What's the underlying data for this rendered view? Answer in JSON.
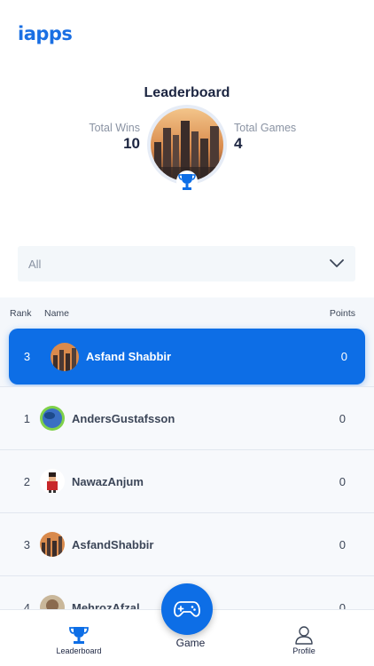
{
  "app": {
    "logo": "iapps"
  },
  "header": {
    "title": "Leaderboard"
  },
  "stats": {
    "wins": {
      "label": "Total Wins",
      "value": "10"
    },
    "games": {
      "label": "Total Games",
      "value": "4"
    }
  },
  "filter": {
    "selected": "All"
  },
  "table": {
    "headers": {
      "rank": "Rank",
      "name": "Name",
      "points": "Points"
    },
    "current_user": {
      "rank": "3",
      "name": "Asfand Shabbir",
      "points": "0"
    },
    "rows": [
      {
        "rank": "1",
        "name": "AndersGustafsson",
        "points": "0"
      },
      {
        "rank": "2",
        "name": "NawazAnjum",
        "points": "0"
      },
      {
        "rank": "3",
        "name": "AsfandShabbir",
        "points": "0"
      },
      {
        "rank": "4",
        "name": "MehrozAfzal",
        "points": "0"
      }
    ]
  },
  "tabbar": {
    "leaderboard": "Leaderboard",
    "game": "Game",
    "profile": "Profile"
  },
  "colors": {
    "accent": "#0d6ee6",
    "logo": "#1a6fe3",
    "text": "#1c2541"
  }
}
